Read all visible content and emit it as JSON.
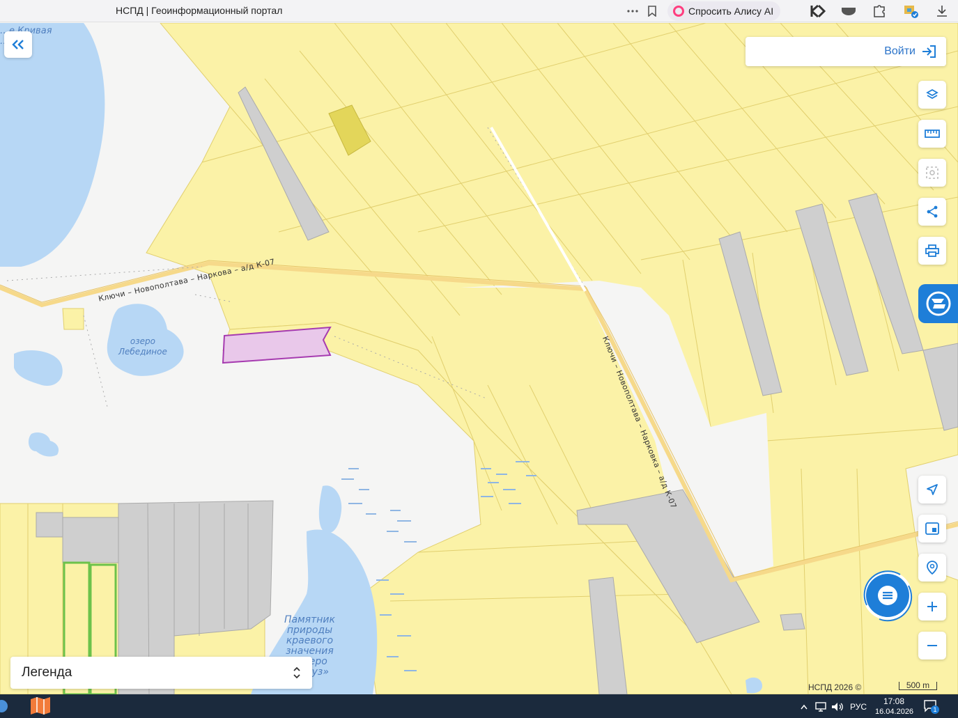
{
  "browser": {
    "tab_title": "НСПД | Геоинформационный портал",
    "alice_label": "Спросить Алису AI"
  },
  "auth": {
    "login_label": "Войти"
  },
  "map": {
    "labels": {
      "lake_krivaya": "…е Кривая\n…на",
      "lake_lebedinoe": "озеро\nЛебединое",
      "monument": "Памятник\nприроды\nкраевого\nзначения\n«озеро\n…отуз»"
    },
    "roads": {
      "road_west": "Ключи – Новополтава – Наркова – а/д К-07",
      "road_east": "Ключи – Новополтава – Нарковка – а/д К-07"
    },
    "copyright": "НСПД 2026 ©",
    "scale": "500 m"
  },
  "legend": {
    "title": "Легенда"
  },
  "controls": {
    "icons": [
      "layers-icon",
      "ruler-icon",
      "select-area-icon",
      "share-icon",
      "print-icon",
      "location-arrow-icon",
      "minimap-icon",
      "geo-search-icon",
      "zoom-in-icon",
      "zoom-out-icon"
    ]
  },
  "taskbar": {
    "lang": "РУС",
    "time": "17:08",
    "date": "16.04.2026",
    "notifications": "1"
  },
  "colors": {
    "parcel": "#fbf2a7",
    "parcel_stroke": "#e1cf6e",
    "road": "#f6d98a",
    "water": "#b7d7f5",
    "gray_parcel": "#cfcfcf",
    "selected_parcel": "#e9c8ea",
    "selected_stroke": "#a63bb0",
    "accent": "#1e7ed8"
  }
}
